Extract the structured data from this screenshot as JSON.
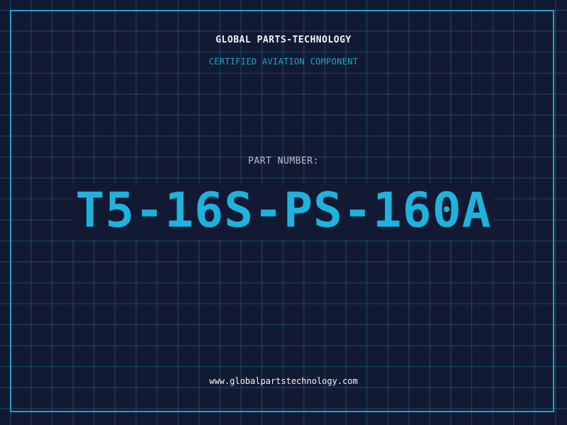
{
  "header": {
    "company": "GLOBAL PARTS-TECHNOLOGY",
    "subtitle": "CERTIFIED AVIATION COMPONENT"
  },
  "part": {
    "label": "PART NUMBER:",
    "number": "T5-16S-PS-160A"
  },
  "footer": {
    "url": "www.globalpartstechnology.com"
  },
  "colors": {
    "background": "#121a33",
    "accent": "#1eb3dc",
    "border": "#1fa3c9",
    "text": "#f2f4f7",
    "muted": "#b9bfcc"
  }
}
